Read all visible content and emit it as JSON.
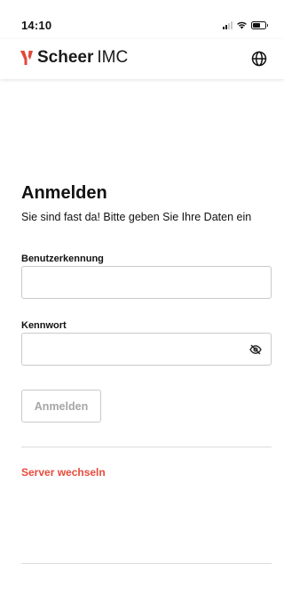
{
  "status_bar": {
    "time": "14:10"
  },
  "header": {
    "brand_bold": "Scheer",
    "brand_light": "IMC",
    "logo_icon": "scheer-logo-mark",
    "language_icon": "globe-icon"
  },
  "login": {
    "title": "Anmelden",
    "subtitle": "Sie sind fast da! Bitte geben Sie Ihre Daten ein",
    "username_label": "Benutzerkennung",
    "username_value": "",
    "password_label": "Kennwort",
    "password_value": "",
    "password_toggle_icon": "eye-slash-icon",
    "submit_label": "Anmelden",
    "submit_enabled": false,
    "switch_server_label": "Server wechseln"
  },
  "colors": {
    "brand_red": "#e5463a",
    "link_red": "#e84b3c",
    "disabled_text": "#a6a6a6",
    "border": "#c9c9c9"
  }
}
